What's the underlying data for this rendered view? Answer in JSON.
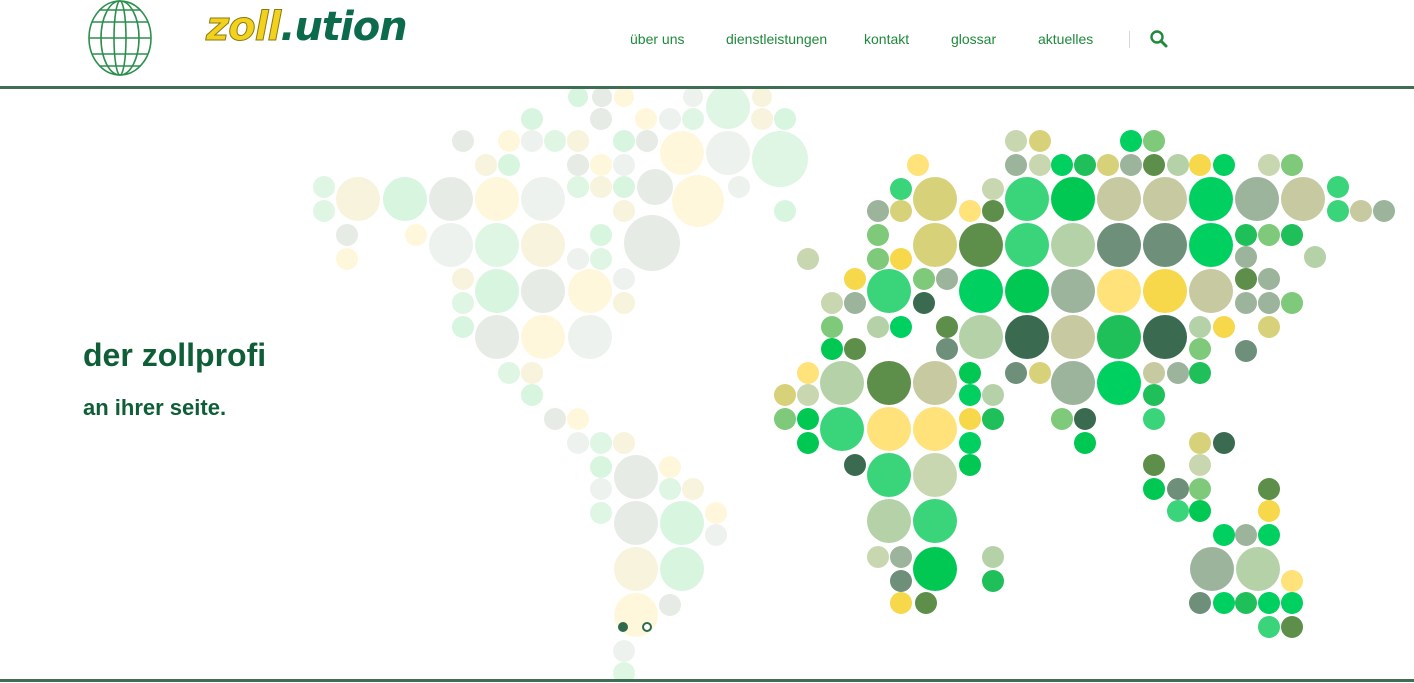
{
  "brand": {
    "logo_part1": "zoll",
    "logo_part2": ".ution"
  },
  "nav": {
    "items": [
      {
        "label": "über uns"
      },
      {
        "label": "dienstleistungen"
      },
      {
        "label": "kontakt"
      },
      {
        "label": "glossar"
      },
      {
        "label": "aktuelles"
      }
    ],
    "search_icon": "search-icon"
  },
  "hero": {
    "headline": "der zollprofi",
    "subline": "an ihrer seite.",
    "slides_total": 2,
    "slide_active": 1
  },
  "colors": {
    "brand_green": "#0f5e37",
    "nav_green": "#1f8a3c",
    "rule_green": "#3f6e55",
    "logo_yellow": "#f3d21e"
  }
}
